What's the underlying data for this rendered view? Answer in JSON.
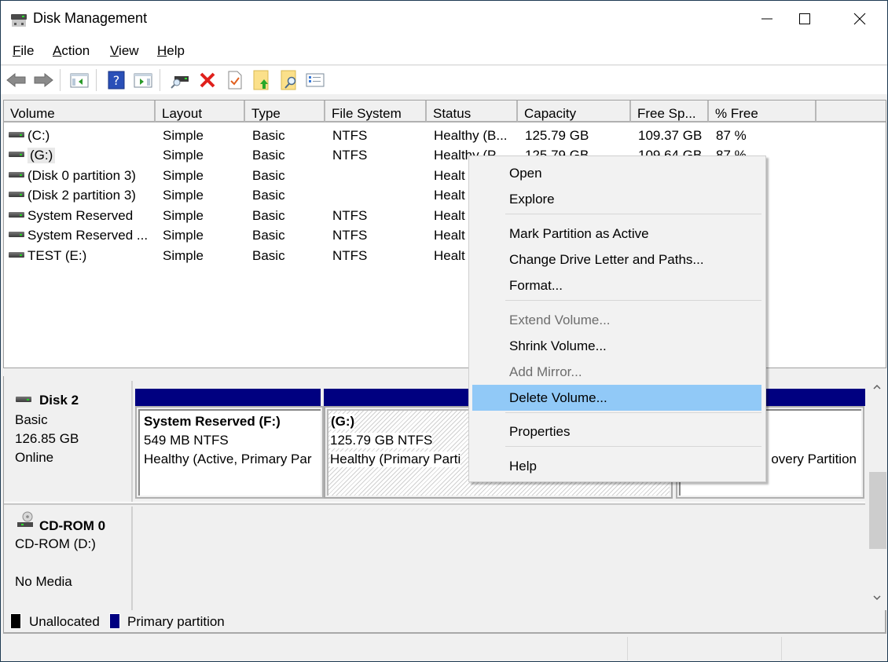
{
  "window": {
    "title": "Disk Management",
    "controls": {
      "minimize": "minimize",
      "maximize": "maximize",
      "close": "close"
    }
  },
  "menubar": {
    "items": [
      {
        "label": "File",
        "accesskey": "F"
      },
      {
        "label": "Action",
        "accesskey": "A"
      },
      {
        "label": "View",
        "accesskey": "V"
      },
      {
        "label": "Help",
        "accesskey": "H"
      }
    ]
  },
  "toolbar": {
    "buttons": [
      {
        "icon": "back-arrow-icon",
        "label": "Back"
      },
      {
        "icon": "forward-arrow-icon",
        "label": "Forward"
      },
      {
        "icon": "show-hide-console-tree-icon",
        "label": "Show/Hide Console Tree"
      },
      {
        "icon": "help-icon",
        "label": "Help"
      },
      {
        "icon": "show-hide-action-pane-icon",
        "label": "Show/Hide Action Pane"
      },
      {
        "icon": "connect-drive-icon",
        "label": "Connect Virtual Disk"
      },
      {
        "icon": "delete-icon",
        "label": "Delete"
      },
      {
        "icon": "properties-check-icon",
        "label": "Properties"
      },
      {
        "icon": "folder-up-icon",
        "label": "Open"
      },
      {
        "icon": "folder-search-icon",
        "label": "Explore"
      },
      {
        "icon": "checklist-icon",
        "label": "Settings"
      }
    ]
  },
  "volume_list": {
    "columns": [
      "Volume",
      "Layout",
      "Type",
      "File System",
      "Status",
      "Capacity",
      "Free Sp...",
      "% Free"
    ],
    "rows": [
      {
        "volume": " (C:)",
        "layout": "Simple",
        "type": "Basic",
        "fs": "NTFS",
        "status": "Healthy (B...",
        "capacity": "125.79 GB",
        "free": "109.37 GB",
        "pct": "87 %"
      },
      {
        "volume": " (G:)",
        "layout": "Simple",
        "type": "Basic",
        "fs": "NTFS",
        "status": "Healthy (P...",
        "capacity": "125.79 GB",
        "free": "109.64 GB",
        "pct": "87 %",
        "selected": true
      },
      {
        "volume": "(Disk 0 partition 3)",
        "layout": "Simple",
        "type": "Basic",
        "fs": "",
        "status": "Healt",
        "capacity": "",
        "free": "",
        "pct": ""
      },
      {
        "volume": "(Disk 2 partition 3)",
        "layout": "Simple",
        "type": "Basic",
        "fs": "",
        "status": "Healt",
        "capacity": "",
        "free": "",
        "pct": ""
      },
      {
        "volume": "System Reserved",
        "layout": "Simple",
        "type": "Basic",
        "fs": "NTFS",
        "status": "Healt",
        "capacity": "",
        "free": "",
        "pct": ""
      },
      {
        "volume": "System Reserved ...",
        "layout": "Simple",
        "type": "Basic",
        "fs": "NTFS",
        "status": "Healt",
        "capacity": "",
        "free": "",
        "pct": ""
      },
      {
        "volume": "TEST (E:)",
        "layout": "Simple",
        "type": "Basic",
        "fs": "NTFS",
        "status": "Healt",
        "capacity": "",
        "free": "",
        "pct": ""
      }
    ]
  },
  "disks": [
    {
      "name": "Disk 2",
      "type": "Basic",
      "size": "126.85 GB",
      "state": "Online",
      "partitions": [
        {
          "title": "System Reserved  (F:)",
          "size_fs": "549 MB NTFS",
          "status": "Healthy (Active, Primary Par"
        },
        {
          "title": " (G:)",
          "size_fs": "125.79 GB NTFS",
          "status": "Healthy (Primary Parti",
          "selected": true
        },
        {
          "title": "",
          "size_fs": "",
          "status": "overy Partition"
        }
      ]
    },
    {
      "name": "CD-ROM 0",
      "type": "CD-ROM (D:)",
      "state": "No Media"
    }
  ],
  "legend": [
    {
      "label": "Unallocated",
      "color": "#000000"
    },
    {
      "label": "Primary partition",
      "color": "#000080"
    }
  ],
  "context_menu": {
    "items": [
      {
        "label": "Open",
        "enabled": true
      },
      {
        "label": "Explore",
        "enabled": true
      },
      {
        "label": "Mark Partition as Active",
        "enabled": true
      },
      {
        "label": "Change Drive Letter and Paths...",
        "enabled": true
      },
      {
        "label": "Format...",
        "enabled": true
      },
      {
        "label": "Extend Volume...",
        "enabled": false
      },
      {
        "label": "Shrink Volume...",
        "enabled": true
      },
      {
        "label": "Add Mirror...",
        "enabled": false
      },
      {
        "label": "Delete Volume...",
        "enabled": true,
        "highlighted": true
      },
      {
        "label": "Properties",
        "enabled": true
      },
      {
        "label": "Help",
        "enabled": true
      }
    ]
  },
  "colors": {
    "primary_partition": "#000080",
    "menu_highlight": "#91c9f7",
    "delete_red": "#e0201c"
  }
}
